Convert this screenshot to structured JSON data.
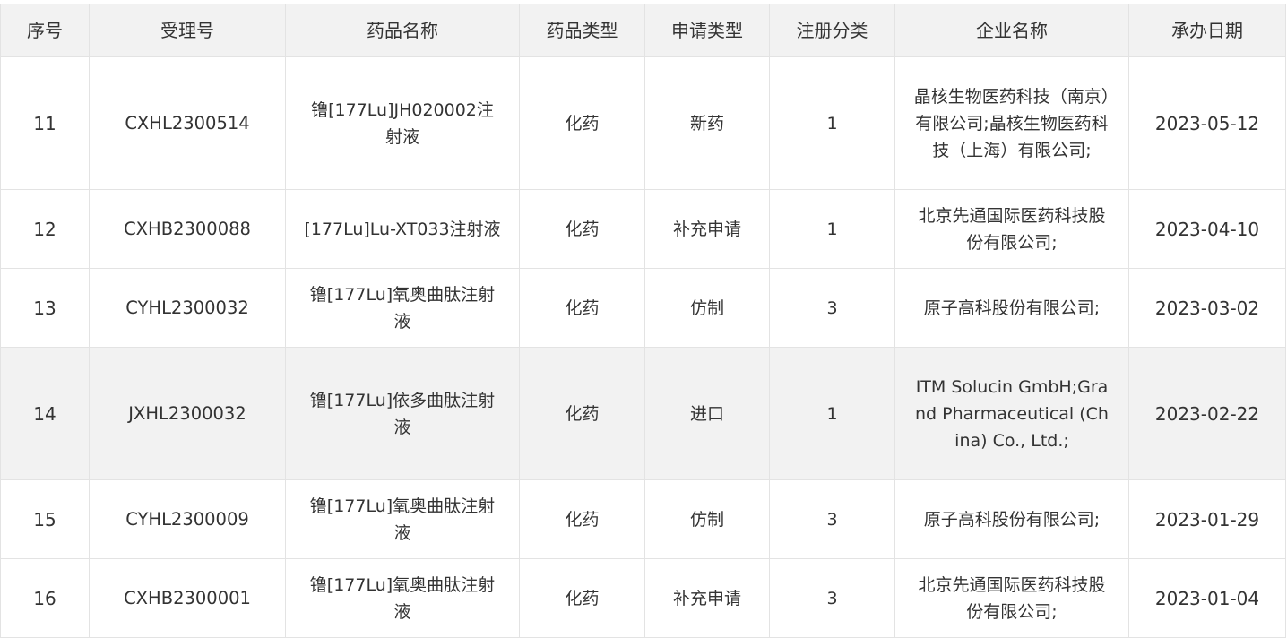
{
  "table": {
    "headers": [
      {
        "key": "no",
        "label": "序号"
      },
      {
        "key": "id",
        "label": "受理号"
      },
      {
        "key": "name",
        "label": "药品名称"
      },
      {
        "key": "drug_type",
        "label": "药品类型"
      },
      {
        "key": "apply_type",
        "label": "申请类型"
      },
      {
        "key": "reg_class",
        "label": "注册分类"
      },
      {
        "key": "company",
        "label": "企业名称"
      },
      {
        "key": "date",
        "label": "承办日期"
      }
    ],
    "rows": [
      {
        "no": "11",
        "id": "CXHL2300514",
        "name": "镥[177Lu]JH020002注射液",
        "drug_type": "化药",
        "apply_type": "新药",
        "reg_class": "1",
        "company": "晶核生物医药科技（南京）有限公司;晶核生物医药科技（上海）有限公司;",
        "date": "2023-05-12"
      },
      {
        "no": "12",
        "id": "CXHB2300088",
        "name": "[177Lu]Lu-XT033注射液",
        "drug_type": "化药",
        "apply_type": "补充申请",
        "reg_class": "1",
        "company": "北京先通国际医药科技股份有限公司;",
        "date": "2023-04-10"
      },
      {
        "no": "13",
        "id": "CYHL2300032",
        "name": "镥[177Lu]氧奥曲肽注射液",
        "drug_type": "化药",
        "apply_type": "仿制",
        "reg_class": "3",
        "company": "原子高科股份有限公司;",
        "date": "2023-03-02"
      },
      {
        "no": "14",
        "id": "JXHL2300032",
        "name": "镥[177Lu]依多曲肽注射液",
        "drug_type": "化药",
        "apply_type": "进口",
        "reg_class": "1",
        "company": "ITM Solucin GmbH;Grand Pharmaceutical (China) Co., Ltd.;",
        "date": "2023-02-22"
      },
      {
        "no": "15",
        "id": "CYHL2300009",
        "name": "镥[177Lu]氧奥曲肽注射液",
        "drug_type": "化药",
        "apply_type": "仿制",
        "reg_class": "3",
        "company": "原子高科股份有限公司;",
        "date": "2023-01-29"
      },
      {
        "no": "16",
        "id": "CXHB2300001",
        "name": "镥[177Lu]氧奥曲肽注射液",
        "drug_type": "化药",
        "apply_type": "补充申请",
        "reg_class": "3",
        "company": "北京先通国际医药科技股份有限公司;",
        "date": "2023-01-04"
      }
    ]
  },
  "colors": {
    "header_bg": "#f2f2f2",
    "hover_row_bg": "#f2f2f2",
    "border": "#e3e3e3",
    "text": "#333333"
  }
}
